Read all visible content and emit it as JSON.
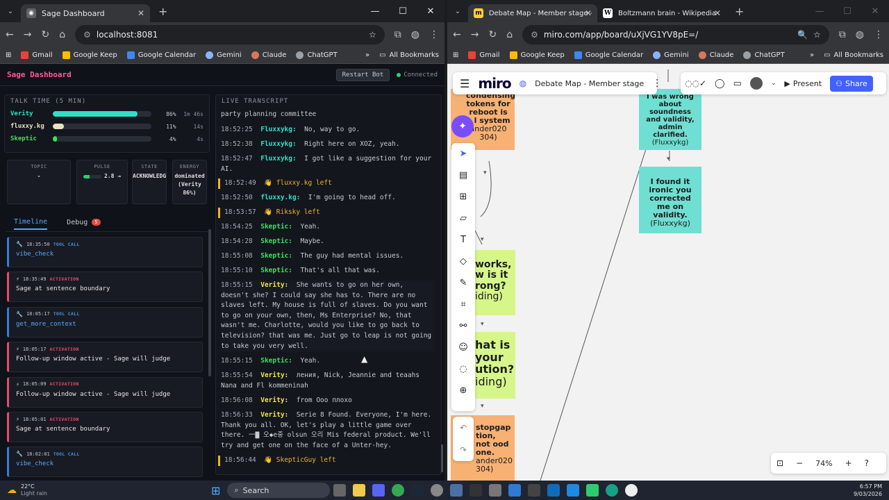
{
  "left_browser": {
    "tab_title": "Sage Dashboard",
    "url": "localhost:8081",
    "bookmarks": [
      "Gmail",
      "Google Keep",
      "Google Calendar",
      "Gemini",
      "Claude",
      "ChatGPT"
    ],
    "all_bookmarks": "All Bookmarks"
  },
  "right_browser": {
    "tabs": [
      "Debate Map - Member stage - Miro",
      "Boltzmann brain - Wikipedia"
    ],
    "url": "miro.com/app/board/uXjVG1YV8pE=/",
    "bookmarks": [
      "Gmail",
      "Google Keep",
      "Google Calendar",
      "Gemini",
      "Claude",
      "ChatGPT"
    ],
    "all_bookmarks": "All Bookmarks"
  },
  "sage": {
    "title": "Sage Dashboard",
    "restart": "Restart Bot",
    "status": "Connected",
    "talk_header": "TALK TIME (5 MIN)",
    "talk": [
      {
        "name": "Verity",
        "pct_value": 86,
        "pct": "86%",
        "time": "1m 46s",
        "color": "#2de0c8"
      },
      {
        "name": "fluxxy.kg",
        "pct_value": 11,
        "pct": "11%",
        "time": "14s",
        "color": "#e8e2c0"
      },
      {
        "name": "Skeptic",
        "pct_value": 4,
        "pct": "4%",
        "time": "4s",
        "color": "#3ee060"
      }
    ],
    "stats": [
      {
        "label": "TOPIC",
        "value": "-"
      },
      {
        "label": "PULSE",
        "value": "2.8 →"
      },
      {
        "label": "STATE",
        "value": "ACKNOWLEDGE"
      },
      {
        "label": "ENERGY",
        "value": "dominated (Verity 86%)"
      }
    ],
    "pulse_level": 0.35,
    "tab_timeline": "Timeline",
    "tab_debug": "Debug",
    "debug_count": "5",
    "events": [
      {
        "time": "18:35:50",
        "kind": "TOOL CALL",
        "detail": "vibe_check",
        "type": "tool"
      },
      {
        "time": "18:35:49",
        "kind": "ACTIVATION",
        "detail": "Sage at sentence boundary",
        "type": "act"
      },
      {
        "time": "18:05:17",
        "kind": "TOOL CALL",
        "detail": "get_more_context",
        "type": "tool"
      },
      {
        "time": "18:05:17",
        "kind": "ACTIVATION",
        "detail": "Follow-up window active - Sage will judge",
        "type": "act"
      },
      {
        "time": "18:05:09",
        "kind": "ACTIVATION",
        "detail": "Follow-up window active - Sage will judge",
        "type": "act"
      },
      {
        "time": "18:05:01",
        "kind": "ACTIVATION",
        "detail": "Sage at sentence boundary",
        "type": "act"
      },
      {
        "time": "18:02:01",
        "kind": "TOOL CALL",
        "detail": "vibe_check",
        "type": "tool"
      }
    ],
    "live_header": "LIVE TRANSCRIPT",
    "transcript_top": "party planning committee",
    "transcript": [
      {
        "t": "18:52:25",
        "s": "Fluxxykg:",
        "c": "#2de0c8",
        "x": "No, way to go."
      },
      {
        "t": "18:52:38",
        "s": "Fluxxykg:",
        "c": "#2de0c8",
        "x": "Right here on XOZ, yeah."
      },
      {
        "t": "18:52:47",
        "s": "Fluxxykg:",
        "c": "#2de0c8",
        "x": "I got like a suggestion for your AI."
      },
      {
        "t": "18:52:49",
        "sys": "👋 fluxxy.kg left"
      },
      {
        "t": "18:52:50",
        "s": "fluxxy.kg:",
        "c": "#2de0c8",
        "x": "I'm going to head off."
      },
      {
        "t": "18:53:57",
        "sys": "👋 Riksky left"
      },
      {
        "t": "18:54:25",
        "s": "Skeptic:",
        "c": "#3ee060",
        "x": "Yeah."
      },
      {
        "t": "18:54:28",
        "s": "Skeptic:",
        "c": "#3ee060",
        "x": "Maybe."
      },
      {
        "t": "18:55:08",
        "s": "Skeptic:",
        "c": "#3ee060",
        "x": "The guy had mental issues."
      },
      {
        "t": "18:55:10",
        "s": "Skeptic:",
        "c": "#3ee060",
        "x": "That's all that was."
      },
      {
        "t": "18:55:15",
        "s": "Verity:",
        "c": "#f5e642",
        "x": "She wants to go on her own, doesn't she? I could say she has to. There are no slaves left. My house is full of slaves. Do you want to go on your own, then, Ms Enterprise? No, that wasn't me. Charlotte, would you like to go back to television? that was me. Just go to leap is not going to take you very well."
      },
      {
        "t": "18:55:15",
        "s": "Skeptic:",
        "c": "#3ee060",
        "x": "Yeah."
      },
      {
        "t": "18:55:54",
        "s": "Verity:",
        "c": "#f5e642",
        "x": "ления, Nick, Jeannie and teaahs Nana and Fl kommeninah"
      },
      {
        "t": "18:56:08",
        "s": "Verity:",
        "c": "#f5e642",
        "x": "from Ооо плохо"
      },
      {
        "t": "18:56:33",
        "s": "Verity:",
        "c": "#f5e642",
        "x": "Serie 8 Found. Everyone, I'm here. Thank you all. OK, let's play a little game over there. 一▇ 오◆e중 olsun 오리 Mis federal product. We'll try and get one on the face of a Unter-hey."
      },
      {
        "t": "18:56:44",
        "sys": "👋 SkepticGuy left"
      }
    ]
  },
  "miro": {
    "brand": "miro",
    "board": "Debate Map - Member stage",
    "present": "Present",
    "share": "Share",
    "zoom": "74%",
    "stickies": [
      "condensing tokens for reboot is a   l system",
      "ander020 304)",
      "I was wrong about soundness and validity, admin clarified.",
      "(Fluxxykg)",
      "I found it ironic you corrected me on validity.",
      "(Fluxxykg)",
      "works, w is it rong?",
      "iding)",
      "hat is your ution?",
      "iding)",
      "stopgap tion, not ood one.",
      "ander020 304)"
    ]
  },
  "taskbar": {
    "temp": "22°C",
    "weather": "Light rain",
    "search": "Search",
    "time": "6:57 PM",
    "date": "9/03/2026"
  }
}
